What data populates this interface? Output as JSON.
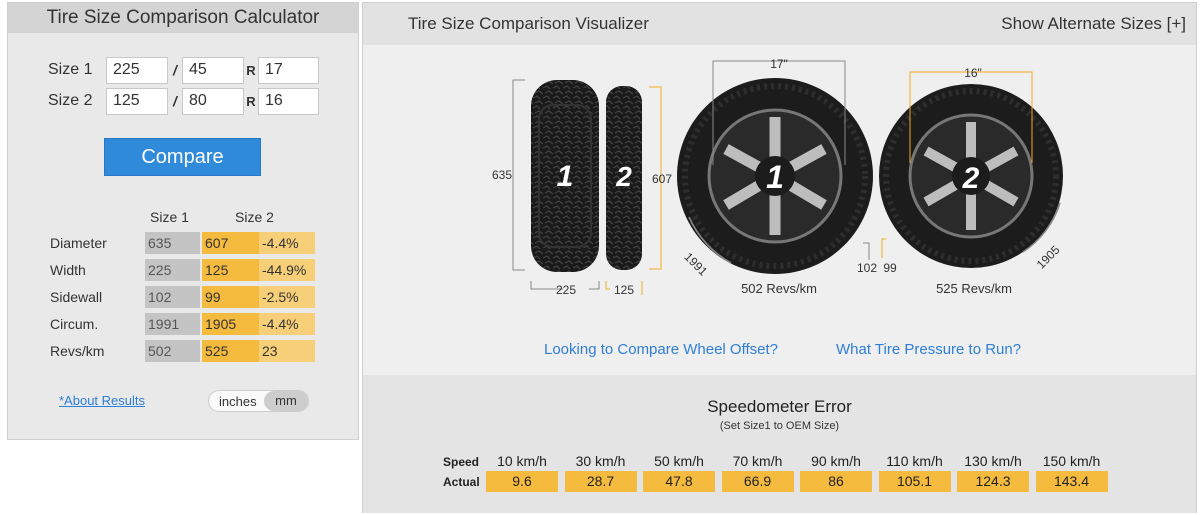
{
  "calculator": {
    "title": "Tire Size Comparison Calculator",
    "size1": {
      "label": "Size 1",
      "width": "225",
      "aspect": "45",
      "rim": "17"
    },
    "size2": {
      "label": "Size 2",
      "width": "125",
      "aspect": "80",
      "rim": "16"
    },
    "slash": "/",
    "r_label": "R",
    "compare_label": "Compare",
    "results": {
      "headers": [
        "Size 1",
        "Size 2"
      ],
      "rows": [
        {
          "name": "Diameter",
          "s1": "635",
          "s2": "607",
          "diff": "-4.4%"
        },
        {
          "name": "Width",
          "s1": "225",
          "s2": "125",
          "diff": "-44.9%"
        },
        {
          "name": "Sidewall",
          "s1": "102",
          "s2": "99",
          "diff": "-2.5%"
        },
        {
          "name": "Circum.",
          "s1": "1991",
          "s2": "1905",
          "diff": "-4.4%"
        },
        {
          "name": "Revs/km",
          "s1": "502",
          "s2": "525",
          "diff": "23"
        }
      ]
    },
    "about_link": "*About Results",
    "units": {
      "inches": "inches",
      "mm": "mm",
      "selected": "mm"
    }
  },
  "visualizer": {
    "title": "Tire Size Comparison Visualizer",
    "alternate_link": "Show Alternate Sizes [+]",
    "tread": {
      "tire1_number": "1",
      "tire2_number": "2",
      "height1": "635",
      "height2": "607",
      "width1": "225",
      "width2": "125"
    },
    "wheel1": {
      "number": "1",
      "rim_label": "17\"",
      "sidewall": "102",
      "circumference": "1991",
      "revs": "502 Revs/km"
    },
    "wheel2": {
      "number": "2",
      "rim_label": "16\"",
      "sidewall": "99",
      "circumference": "1905",
      "revs": "525 Revs/km"
    },
    "links": {
      "offset": "Looking to Compare Wheel Offset?",
      "pressure": "What Tire Pressure to Run?"
    }
  },
  "speedometer": {
    "title": "Speedometer Error",
    "subtitle": "(Set Size1 to OEM Size)",
    "speed_label": "Speed",
    "actual_label": "Actual",
    "speeds": [
      "10 km/h",
      "30 km/h",
      "50 km/h",
      "70 km/h",
      "90 km/h",
      "110 km/h",
      "130 km/h",
      "150 km/h"
    ],
    "actual": [
      "9.6",
      "28.7",
      "47.8",
      "66.9",
      "86",
      "105.1",
      "124.3",
      "143.4"
    ]
  },
  "colors": {
    "accent_blue": "#2f8ad9",
    "size2_orange": "#f5bb3e",
    "diff_orange": "#f7cf78",
    "size1_grey": "#c4c4c4"
  }
}
